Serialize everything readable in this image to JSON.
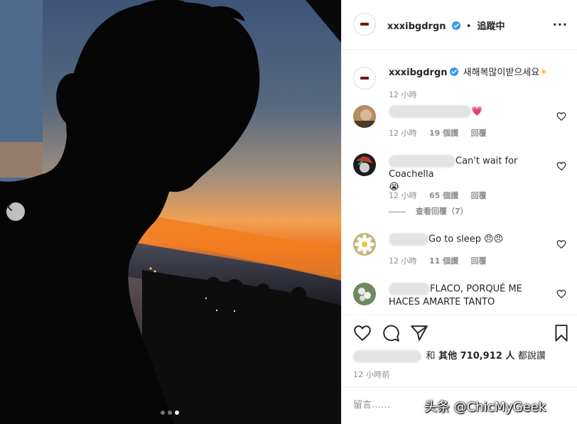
{
  "post": {
    "carousel_index": 3,
    "carousel_count": 3
  },
  "header": {
    "username": "xxxibgdrgn",
    "separator": "•",
    "follow_label": "追蹤中",
    "more_label": "···"
  },
  "caption": {
    "username": "xxxibgdrgn",
    "text": "새해복많이받으세요",
    "emoji": "☀",
    "time": "12 小時"
  },
  "comments": [
    {
      "text": "💗",
      "time": "12 小時",
      "likes": "19 個讚",
      "reply": "回覆"
    },
    {
      "text": "Can't wait for Coachella",
      "emoji": "😭",
      "time": "12 小時",
      "likes": "65 個讚",
      "reply": "回覆",
      "view_replies": "查看回覆（7）"
    },
    {
      "text": "Go to sleep 😠😠",
      "time": "12 小時",
      "likes": "11 個讚",
      "reply": "回覆"
    },
    {
      "text": "FLACO, PORQUÉ ME HACES AMARTE TANTO"
    }
  ],
  "likes": {
    "prefix": "和",
    "others_label": "其他 710,912 人",
    "suffix": "都說讚"
  },
  "timestamp": "12 小時前",
  "add_comment": {
    "placeholder": "留言……"
  },
  "watermark": "头条 @ChicMyGeek",
  "colors": {
    "verified": "#3897f0",
    "text": "#262626",
    "muted": "#8e8e8e",
    "brand_bar": "#6d1a1a"
  }
}
